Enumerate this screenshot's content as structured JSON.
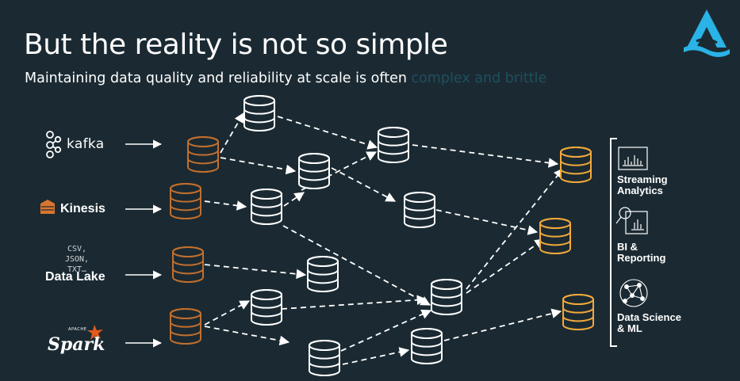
{
  "slide": {
    "title": "But the reality is not so simple",
    "subtitle_lead": "Maintaining data quality and reliability at scale is often ",
    "subtitle_highlight": "complex and brittle"
  },
  "sources": {
    "kafka": "kafka",
    "kinesis": "Kinesis",
    "data_lake": "Data Lake",
    "data_lake_formats": [
      "CSV,",
      "JSON,",
      "TXT…"
    ],
    "spark": "Spark",
    "spark_tag": "APACHE"
  },
  "consumers": {
    "streaming": [
      "Streaming",
      "Analytics"
    ],
    "bi": [
      "BI &",
      "Reporting"
    ],
    "ds": [
      "Data Science",
      "& ML"
    ]
  },
  "colors": {
    "background": "#1b2a32",
    "source_db": "#c26f2d",
    "intermediate_db": "#ffffff",
    "output_db": "#f2a93b",
    "highlight_text": "#1e4f5f",
    "logo": "#2ab3e6"
  },
  "icons": [
    "kafka-logo-icon",
    "kinesis-logo-icon",
    "spark-star-icon",
    "database-icon",
    "bar-chart-icon",
    "magnifier-chart-icon",
    "network-icon",
    "brand-logo-icon"
  ]
}
